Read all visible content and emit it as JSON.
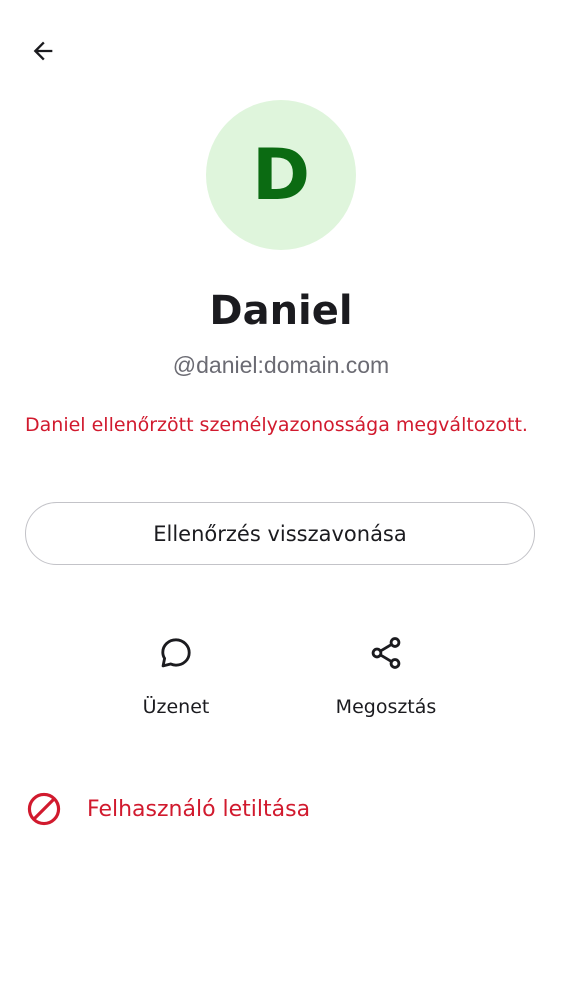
{
  "header": {
    "back_icon": "arrow-left-icon"
  },
  "profile": {
    "avatar_initial": "D",
    "name": "Daniel",
    "user_id": "@daniel:domain.com",
    "identity_warning": "Daniel ellenőrzött személyazonossága megváltozott."
  },
  "verification": {
    "revoke_label": "Ellenőrzés visszavonása"
  },
  "actions": [
    {
      "icon": "chat-bubble-icon",
      "label": "Üzenet"
    },
    {
      "icon": "share-icon",
      "label": "Megosztás"
    }
  ],
  "block": {
    "icon": "block-icon",
    "label": "Felhasználó letiltása"
  },
  "colors": {
    "avatar_bg": "#dff5dc",
    "avatar_text": "#0b6b12",
    "critical": "#d11a2e",
    "secondary_text": "#6b6b73",
    "border": "#c3c3c8"
  }
}
